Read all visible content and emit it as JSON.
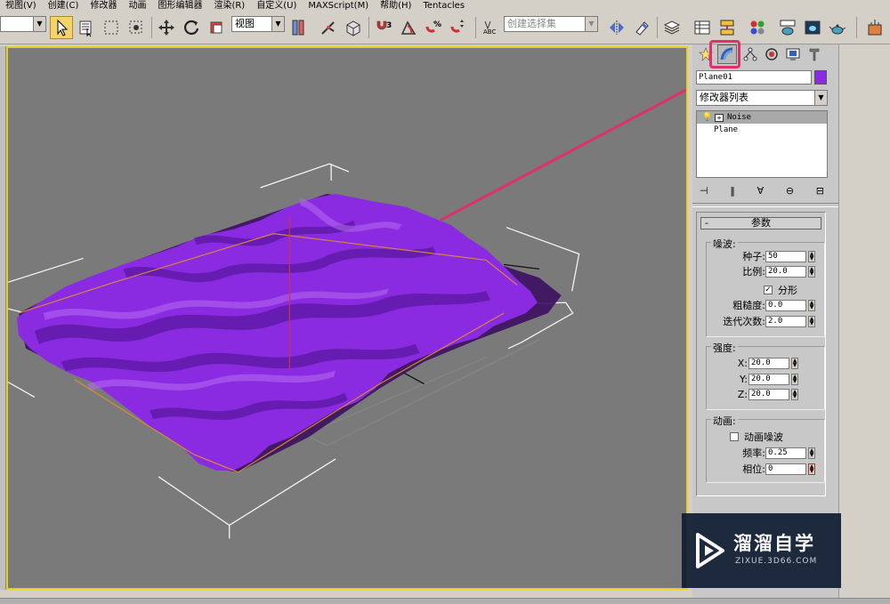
{
  "menu": [
    "视图(V)",
    "创建(C)",
    "修改器",
    "动画",
    "图形编辑器",
    "渲染(R)",
    "自定义(U)",
    "MAXScript(M)",
    "帮助(H)",
    "Tentacles"
  ],
  "toolbar": {
    "view_select": "视图",
    "selection_set_placeholder": "创建选择集"
  },
  "command_panel": {
    "object_name": "Plane01",
    "object_color": "#8a2be2",
    "modifier_list": "修改器列表",
    "stack": [
      {
        "label": "Noise",
        "selected": true
      },
      {
        "label": "Plane",
        "selected": false
      }
    ],
    "rollout_title": "参数",
    "noise_group": {
      "title": "噪波:",
      "seed_label": "种子:",
      "seed_value": "50",
      "scale_label": "比例:",
      "scale_value": "20.0",
      "fractal_label": "分形",
      "fractal_checked": true,
      "roughness_label": "粗糙度:",
      "roughness_value": "0.0",
      "iterations_label": "迭代次数:",
      "iterations_value": "2.0"
    },
    "strength_group": {
      "title": "强度:",
      "x_label": "X:",
      "x_value": "20.0",
      "y_label": "Y:",
      "y_value": "20.0",
      "z_label": "Z:",
      "z_value": "20.0"
    },
    "animation_group": {
      "title": "动画:",
      "animate_noise_label": "动画噪波",
      "animate_noise_checked": false,
      "frequency_label": "频率:",
      "frequency_value": "0.25",
      "phase_label": "相位:",
      "phase_value": "0"
    }
  },
  "watermark": {
    "brand": "溜溜自学",
    "url": "ZIXUE.3D66.COM"
  },
  "colors": {
    "mesh": "#8a2be2",
    "viewport_bg": "#7a7a7a",
    "annotation": "#e0306a",
    "active_border": "#e8d020"
  }
}
